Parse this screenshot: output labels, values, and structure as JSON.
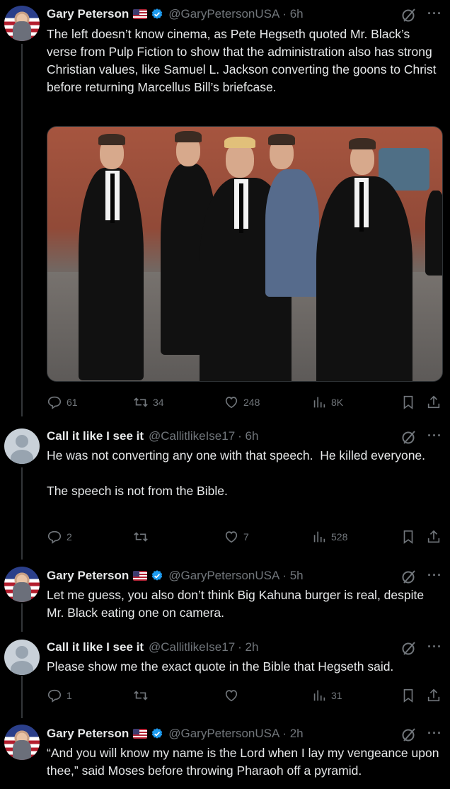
{
  "tweets": [
    {
      "author": "Gary Peterson",
      "handle": "@GaryPetersonUSA",
      "time": "· 6h",
      "text": "The left doesn’t know cinema, as Pete Hegseth quoted Mr. Black’s verse from Pulp Fiction to show that the administration also has strong Christian values, like Samuel L. Jackson converting the goons to Christ before returning Marcellus Bill’s briefcase.",
      "stats": {
        "replies": "61",
        "reposts": "34",
        "likes": "248",
        "views": "8K"
      }
    },
    {
      "author": "Call it like I see it",
      "handle": "@CallitlikeIse17",
      "time": "· 6h",
      "text": "He was not converting any one with that speech.  He killed everyone.\n\nThe speech is not from the Bible.",
      "stats": {
        "replies": "2",
        "reposts": "",
        "likes": "7",
        "views": "528"
      }
    },
    {
      "author": "Gary Peterson",
      "handle": "@GaryPetersonUSA",
      "time": "· 5h",
      "text": "Let me guess, you also don’t think Big Kahuna burger is real, despite Mr. Black eating one on camera."
    },
    {
      "author": "Call it like I see it",
      "handle": "@CallitlikeIse17",
      "time": "· 2h",
      "text": "Please show me the exact quote in the Bible that Hegseth said.",
      "stats": {
        "replies": "1",
        "reposts": "",
        "likes": "",
        "views": "31"
      }
    },
    {
      "author": "Gary Peterson",
      "handle": "@GaryPetersonUSA",
      "time": "· 2h",
      "text": "“And you will know my name is the Lord when I lay my vengeance upon thee,” said Moses before throwing Pharaoh off a pyramid."
    }
  ],
  "icons": {
    "verified": "verified-badge-icon",
    "flag": "us-flag-icon",
    "grok": "grok-icon",
    "more": "more-icon",
    "reply": "reply-icon",
    "repost": "repost-icon",
    "like": "like-icon",
    "views": "views-icon",
    "bookmark": "bookmark-icon",
    "share": "share-icon"
  },
  "colors": {
    "background": "#000000",
    "text": "#e7e9ea",
    "secondary": "#71767b",
    "verified": "#1d9bf0",
    "thread_line": "#333639"
  }
}
